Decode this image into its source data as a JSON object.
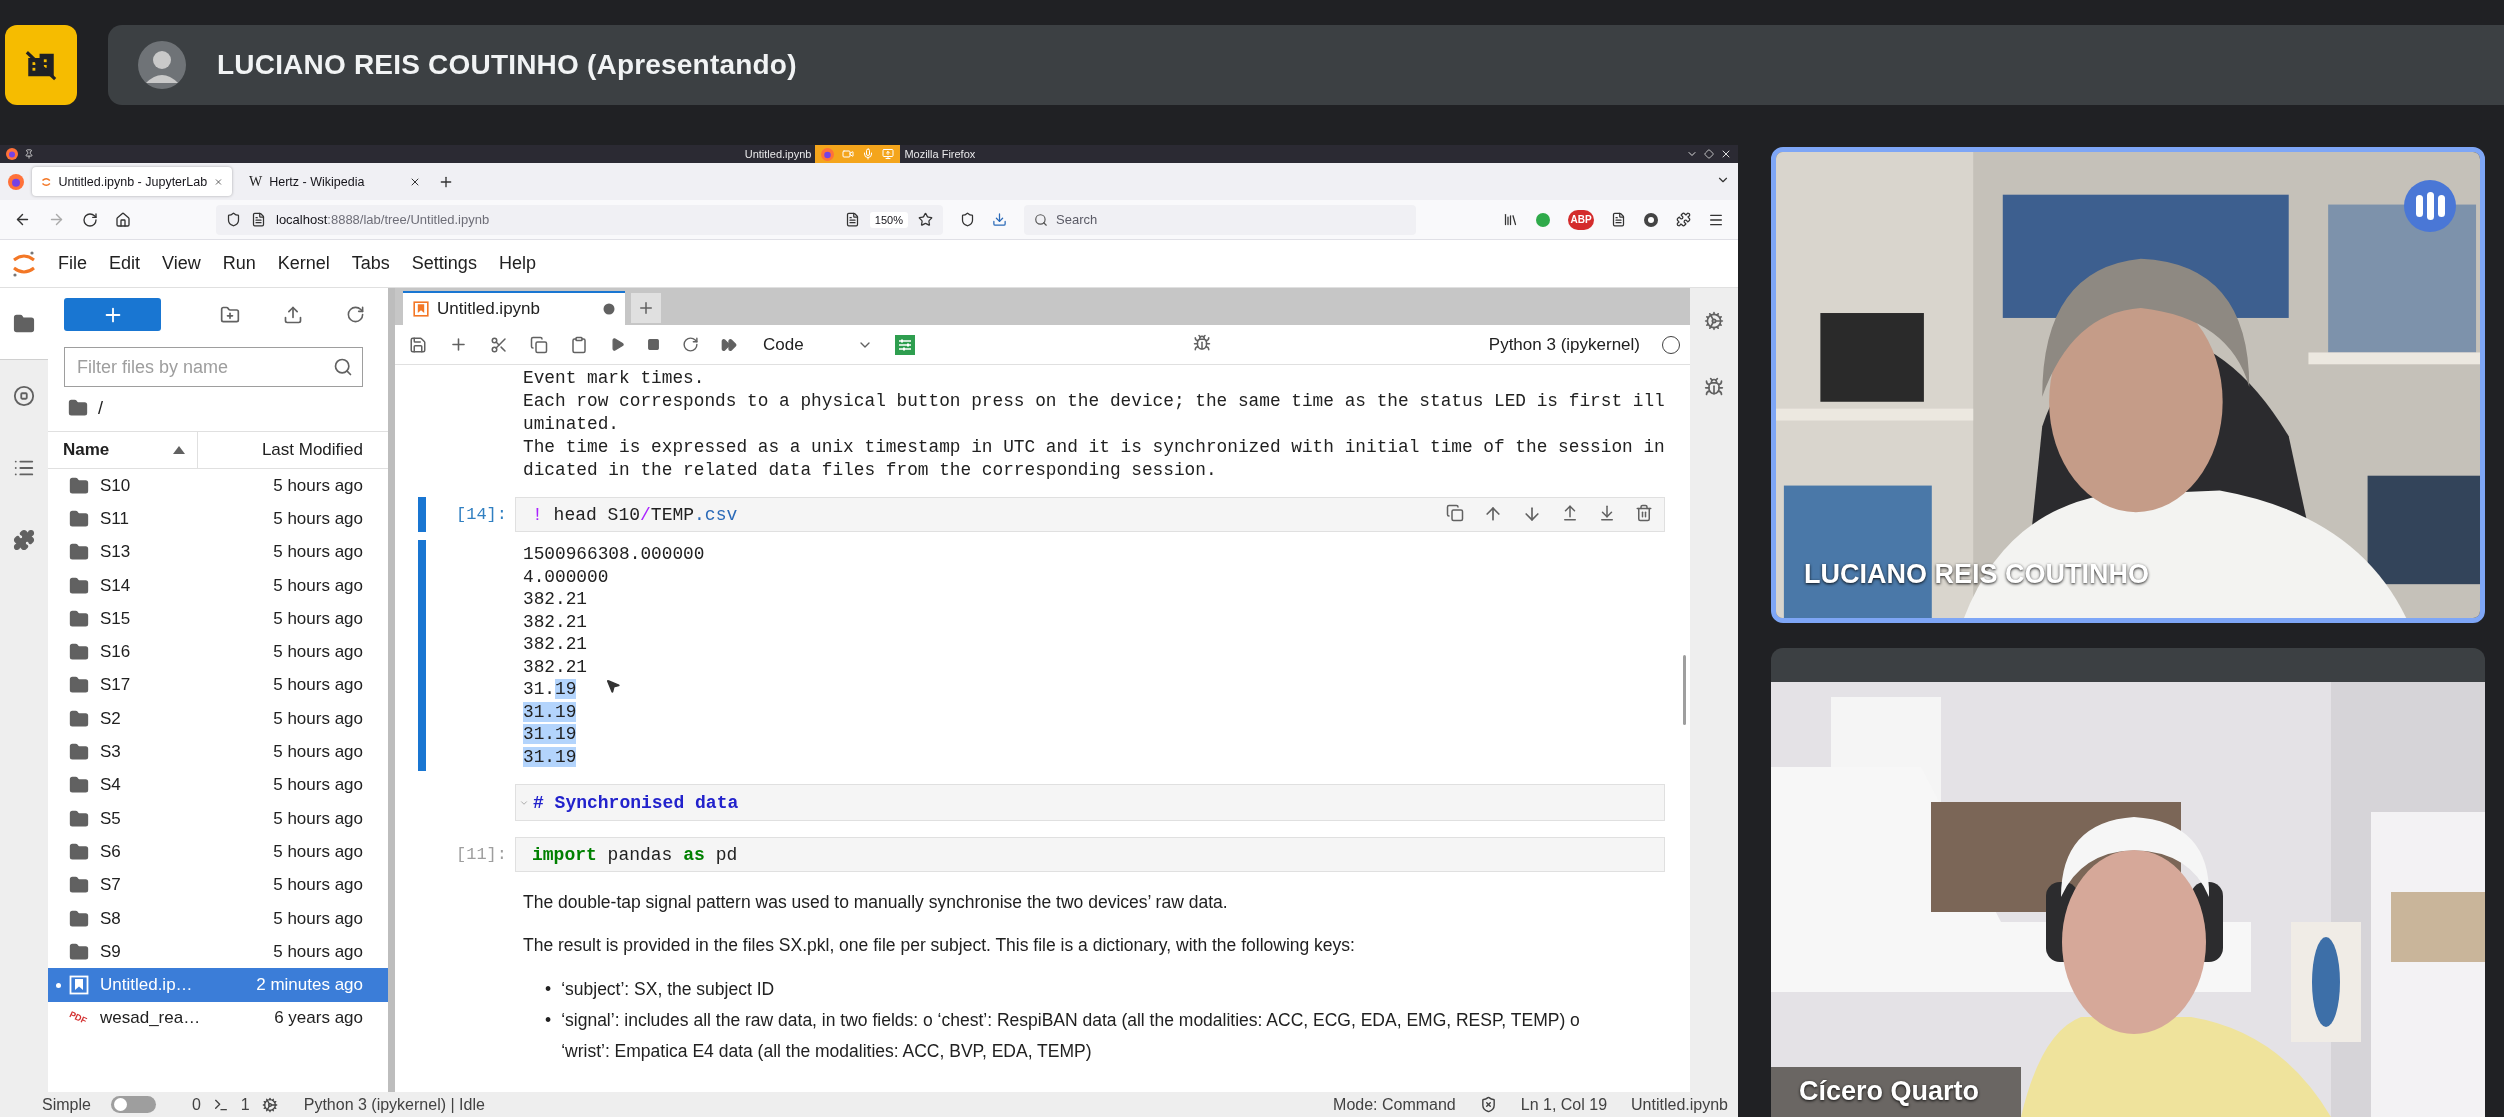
{
  "meeting": {
    "presenter": "LUCIANO REIS COUTINHO (Apresentando)"
  },
  "browser": {
    "title_parts": [
      "Untitled.ipynb",
      "Mozilla Firefox"
    ],
    "tabs": [
      {
        "label": "Untitled.ipynb - JupyterLab",
        "selected": true,
        "kind": "jupyter"
      },
      {
        "label": "Hertz - Wikipedia",
        "selected": false,
        "kind": "wiki",
        "icon_text": "W"
      }
    ],
    "url": {
      "host": "localhost",
      "path": ":8888/lab/tree/Untitled.ipynb"
    },
    "zoom": "150%",
    "search_placeholder": "Search",
    "extension_badge": "ABP"
  },
  "jupyter": {
    "menu": [
      "File",
      "Edit",
      "View",
      "Run",
      "Kernel",
      "Tabs",
      "Settings",
      "Help"
    ],
    "sidebar": [
      {
        "kind": "files",
        "selected": true
      },
      {
        "kind": "running",
        "selected": false
      },
      {
        "kind": "toc",
        "selected": false
      },
      {
        "kind": "extensions",
        "selected": false
      }
    ],
    "file_browser": {
      "filter_placeholder": "Filter files by name",
      "path": "/",
      "columns": [
        {
          "label": "Name",
          "sorted": true
        },
        {
          "label": "Last Modified",
          "sorted": false
        }
      ],
      "files": [
        {
          "name": "S10",
          "modified": "5 hours ago",
          "kind": "folder",
          "selected": false,
          "open": false
        },
        {
          "name": "S11",
          "modified": "5 hours ago",
          "kind": "folder",
          "selected": false,
          "open": false
        },
        {
          "name": "S13",
          "modified": "5 hours ago",
          "kind": "folder",
          "selected": false,
          "open": false
        },
        {
          "name": "S14",
          "modified": "5 hours ago",
          "kind": "folder",
          "selected": false,
          "open": false
        },
        {
          "name": "S15",
          "modified": "5 hours ago",
          "kind": "folder",
          "selected": false,
          "open": false
        },
        {
          "name": "S16",
          "modified": "5 hours ago",
          "kind": "folder",
          "selected": false,
          "open": false
        },
        {
          "name": "S17",
          "modified": "5 hours ago",
          "kind": "folder",
          "selected": false,
          "open": false
        },
        {
          "name": "S2",
          "modified": "5 hours ago",
          "kind": "folder",
          "selected": false,
          "open": false
        },
        {
          "name": "S3",
          "modified": "5 hours ago",
          "kind": "folder",
          "selected": false,
          "open": false
        },
        {
          "name": "S4",
          "modified": "5 hours ago",
          "kind": "folder",
          "selected": false,
          "open": false
        },
        {
          "name": "S5",
          "modified": "5 hours ago",
          "kind": "folder",
          "selected": false,
          "open": false
        },
        {
          "name": "S6",
          "modified": "5 hours ago",
          "kind": "folder",
          "selected": false,
          "open": false
        },
        {
          "name": "S7",
          "modified": "5 hours ago",
          "kind": "folder",
          "selected": false,
          "open": false
        },
        {
          "name": "S8",
          "modified": "5 hours ago",
          "kind": "folder",
          "selected": false,
          "open": false
        },
        {
          "name": "S9",
          "modified": "5 hours ago",
          "kind": "folder",
          "selected": false,
          "open": false
        },
        {
          "name": "Untitled.ip…",
          "modified": "2 minutes ago",
          "kind": "notebook",
          "selected": true,
          "open": true
        },
        {
          "name": "wesad_rea…",
          "modified": "6 years ago",
          "kind": "pdf",
          "selected": false,
          "open": false,
          "icon_text": "PDF"
        }
      ]
    },
    "notebook": {
      "tab": {
        "label": "Untitled.ipynb",
        "unsaved": true
      },
      "cell_type": "Code",
      "kernel": "Python 3 (ipykernel)",
      "kernel_busy": false,
      "cells": [
        {
          "kind": "stream",
          "lines": [
            "Event mark times.",
            "Each row corresponds to a physical button press on the device; the same time as the status LED is first ill",
            "uminated.",
            "The time is expressed as a unix timestamp in UTC and it is synchronized with initial time of the session in",
            "dicated in the related data files from the corresponding session."
          ]
        },
        {
          "kind": "code",
          "prompt": "[14]:",
          "active": true,
          "tokens": [
            {
              "text": "!",
              "kind": "magic"
            },
            {
              "text": " head S10",
              "kind": "plain"
            },
            {
              "text": "/",
              "kind": "operator"
            },
            {
              "text": "TEMP",
              "kind": "plain"
            },
            {
              "text": ".csv",
              "kind": "attribute"
            }
          ]
        },
        {
          "kind": "output",
          "active": true,
          "lines": [
            {
              "segments": [
                {
                  "text": "1500966308.000000",
                  "selected": false
                }
              ]
            },
            {
              "segments": [
                {
                  "text": "4.000000",
                  "selected": false
                }
              ]
            },
            {
              "segments": [
                {
                  "text": "382.21",
                  "selected": false
                }
              ]
            },
            {
              "segments": [
                {
                  "text": "382.21",
                  "selected": false
                }
              ]
            },
            {
              "segments": [
                {
                  "text": "382.21",
                  "selected": false
                }
              ]
            },
            {
              "segments": [
                {
                  "text": "382.21",
                  "selected": false
                }
              ]
            },
            {
              "segments": [
                {
                  "text": "31.",
                  "selected": false
                },
                {
                  "text": "19",
                  "selected": true
                }
              ]
            },
            {
              "segments": [
                {
                  "text": "31.19",
                  "selected": true
                }
              ]
            },
            {
              "segments": [
                {
                  "text": "31.19",
                  "selected": true
                }
              ]
            },
            {
              "segments": [
                {
                  "text": "31.19",
                  "selected": true
                }
              ]
            }
          ]
        },
        {
          "kind": "heading",
          "text": "# Synchronised data",
          "collapsed": false
        },
        {
          "kind": "code",
          "prompt": "[11]:",
          "active": false,
          "tokens": [
            {
              "text": "import",
              "kind": "keyword"
            },
            {
              "text": " pandas ",
              "kind": "plain"
            },
            {
              "text": "as",
              "kind": "keyword"
            },
            {
              "text": " pd",
              "kind": "plain"
            }
          ]
        },
        {
          "kind": "paragraph",
          "text": "The double-tap signal pattern was used to manually synchronise the two devices’ raw data."
        },
        {
          "kind": "paragraph",
          "text": "The result is provided in the files SX.pkl, one file per subject. This file is a dictionary, with the following keys:"
        },
        {
          "kind": "bullets",
          "marker": "•",
          "items": [
            "‘subject’: SX, the subject ID",
            "‘signal’: includes all the raw data, in two fields: o ‘chest’: RespiBAN data (all the modalities: ACC, ECG, EDA, EMG, RESP, TEMP) o ‘wrist’: Empatica E4 data (all the modalities: ACC, BVP, EDA, TEMP)"
          ]
        }
      ]
    }
  },
  "status_bar": {
    "mode_label": "Simple",
    "simple_mode": false,
    "terminals": "0",
    "kernels": "1",
    "kernel_status": "Python 3 (ipykernel) | Idle",
    "mode": "Mode: Command",
    "cursor": "Ln 1, Col 19",
    "file": "Untitled.ipynb"
  },
  "participants": [
    {
      "name": "LUCIANO REIS COUTINHO",
      "speaking": true
    },
    {
      "name": "Cícero Quarto",
      "speaking": false
    }
  ]
}
